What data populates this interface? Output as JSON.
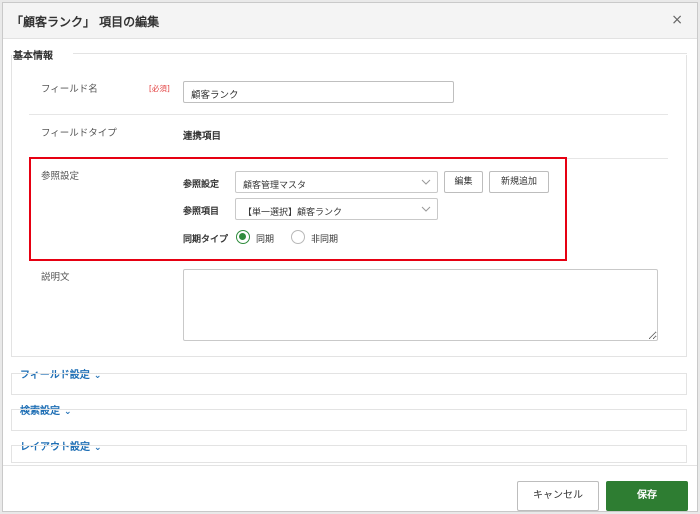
{
  "dialog": {
    "title": "「顧客ランク」 項目の編集",
    "close_glyph": "×"
  },
  "basic": {
    "section_title": "基本情報",
    "field_name_label": "フィールド名",
    "required_badge": "[必須]",
    "field_name_value": "顧客ランク",
    "field_type_label": "フィールドタイプ",
    "field_type_value": "連携項目",
    "reference_settings_label": "参照設定",
    "reference": {
      "ref_setting_label": "参照設定",
      "ref_setting_value": "顧客管理マスタ",
      "edit_button": "編集",
      "add_new_button": "新規追加",
      "ref_item_label": "参照項目",
      "ref_item_value": "【単一選択】顧客ランク",
      "sync_type_label": "同期タイプ",
      "sync_options": [
        {
          "label": "同期",
          "selected": true
        },
        {
          "label": "非同期",
          "selected": false
        }
      ]
    },
    "description_label": "説明文",
    "description_value": ""
  },
  "collapsibles": [
    {
      "label": "フィールド設定"
    },
    {
      "label": "検索設定"
    },
    {
      "label": "レイアウト設定"
    }
  ],
  "footer": {
    "cancel_label": "キャンセル",
    "save_label": "保存"
  },
  "colors": {
    "accent_green": "#2e7d32",
    "highlight_red": "#e60012",
    "link_blue": "#1f6fb5",
    "required_red": "#e23c3c"
  },
  "icons": {
    "close": "close-icon",
    "select_chevron": "chevron-down-icon",
    "collapse_chevron": "chevron-down-icon"
  }
}
